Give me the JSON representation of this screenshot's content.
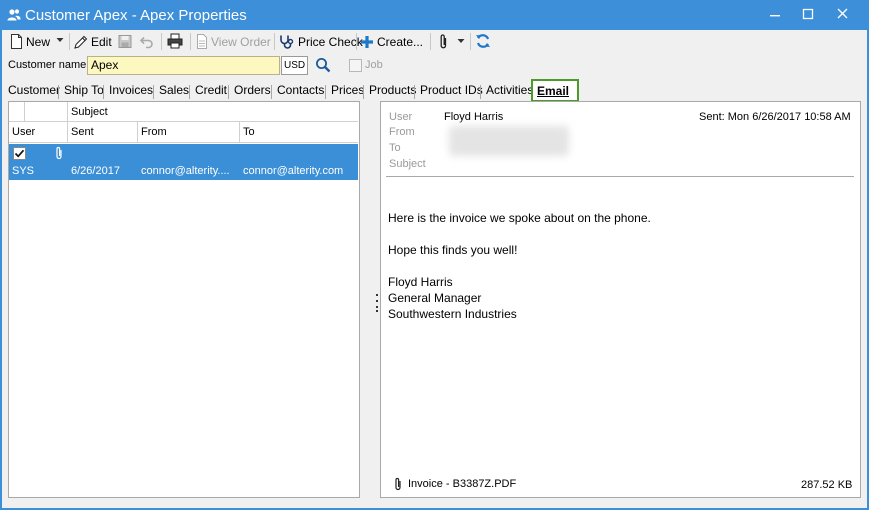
{
  "window": {
    "title": "Customer Apex - Apex Properties",
    "icon": "users-icon",
    "controls": [
      "minimize-icon",
      "maximize-icon",
      "close-icon"
    ]
  },
  "toolbar": {
    "new_label": "New",
    "edit_label": "Edit",
    "view_order_label": "View Order",
    "price_check_label": "Price Check",
    "create_label": "Create..."
  },
  "customer": {
    "label": "Customer name",
    "value": "Apex",
    "currency": "USD",
    "job_label": "Job"
  },
  "tabs": [
    {
      "label": "Customer"
    },
    {
      "label": "Ship To"
    },
    {
      "label": "Invoices"
    },
    {
      "label": "Sales"
    },
    {
      "label": "Credit"
    },
    {
      "label": "Orders"
    },
    {
      "label": "Contacts"
    },
    {
      "label": "Prices"
    },
    {
      "label": "Products"
    },
    {
      "label": "Product IDs"
    },
    {
      "label": "Activities"
    },
    {
      "label": "Email",
      "active": true
    }
  ],
  "email_grid": {
    "header_row1": {
      "subject": "Subject"
    },
    "header_row2": {
      "user": "User",
      "sent": "Sent",
      "from": "From",
      "to": "To"
    },
    "rows": [
      {
        "checked": true,
        "has_attachment": true,
        "user": "SYS",
        "sent": "6/26/2017",
        "from": "connor@alterity....",
        "to": "connor@alterity.com"
      }
    ]
  },
  "email_detail": {
    "labels": {
      "user": "User",
      "from": "From",
      "to": "To",
      "subject": "Subject"
    },
    "user": "Floyd Harris",
    "sent": "Sent: Mon 6/26/2017 10:58 AM",
    "body": [
      "Here is the invoice we spoke about on the phone.",
      "Hope this finds you well!",
      "Floyd Harris",
      "General Manager",
      "Southwestern Industries"
    ],
    "attachment": {
      "name": "Invoice - B3387Z.PDF",
      "size": "287.52 KB"
    }
  },
  "colors": {
    "title_bar": "#3c8fd8",
    "selected_row": "#3b8fd7",
    "customer_input_bg": "#fdf7c0",
    "active_tab_border": "#4c9a2a"
  }
}
